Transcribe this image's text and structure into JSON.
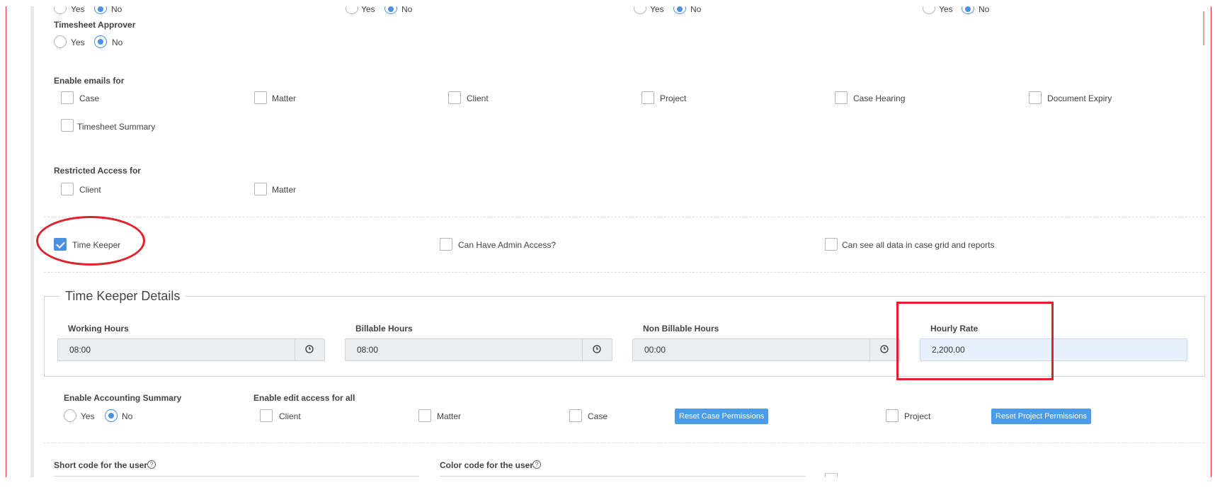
{
  "top_partial": {
    "groups": [
      {
        "yes": "Yes",
        "no": "No"
      },
      {
        "yes": "Yes",
        "no": "No"
      },
      {
        "yes": "Yes",
        "no": "No"
      },
      {
        "yes": "Yes",
        "no": "No"
      }
    ]
  },
  "timesheet_approver": {
    "label": "Timesheet Approver",
    "yes": "Yes",
    "no": "No",
    "selected": "No"
  },
  "enable_emails": {
    "label": "Enable emails for",
    "options": [
      "Case",
      "Matter",
      "Client",
      "Project",
      "Case Hearing",
      "Document Expiry",
      "Timesheet Summary"
    ]
  },
  "restricted_access": {
    "label": "Restricted Access for",
    "options": [
      "Client",
      "Matter"
    ]
  },
  "flags": {
    "time_keeper": {
      "label": "Time Keeper",
      "checked": true
    },
    "admin_access": {
      "label": "Can Have Admin Access?",
      "checked": false
    },
    "see_all_data": {
      "label": "Can see all data in case grid and reports",
      "checked": false
    }
  },
  "time_keeper_details": {
    "legend": "Time Keeper Details",
    "working_hours": {
      "label": "Working Hours",
      "value": "08:00"
    },
    "billable_hours": {
      "label": "Billable Hours",
      "value": "08:00"
    },
    "non_billable_hours": {
      "label": "Non Billable Hours",
      "value": "00:00"
    },
    "hourly_rate": {
      "label": "Hourly Rate",
      "value": "2,200.00"
    }
  },
  "accounting_summary": {
    "label": "Enable Accounting Summary",
    "yes": "Yes",
    "no": "No",
    "selected": "No"
  },
  "edit_access": {
    "label": "Enable edit access for all",
    "client": "Client",
    "matter": "Matter",
    "case": "Case",
    "reset_case": "Reset Case Permissions",
    "project": "Project",
    "reset_project": "Reset Project Permissions"
  },
  "short_code": {
    "label": "Short code for the user"
  },
  "color_code": {
    "label": "Color code for the user"
  },
  "colors": {
    "accent": "#4a90e2",
    "annotation": "#e0212b"
  }
}
